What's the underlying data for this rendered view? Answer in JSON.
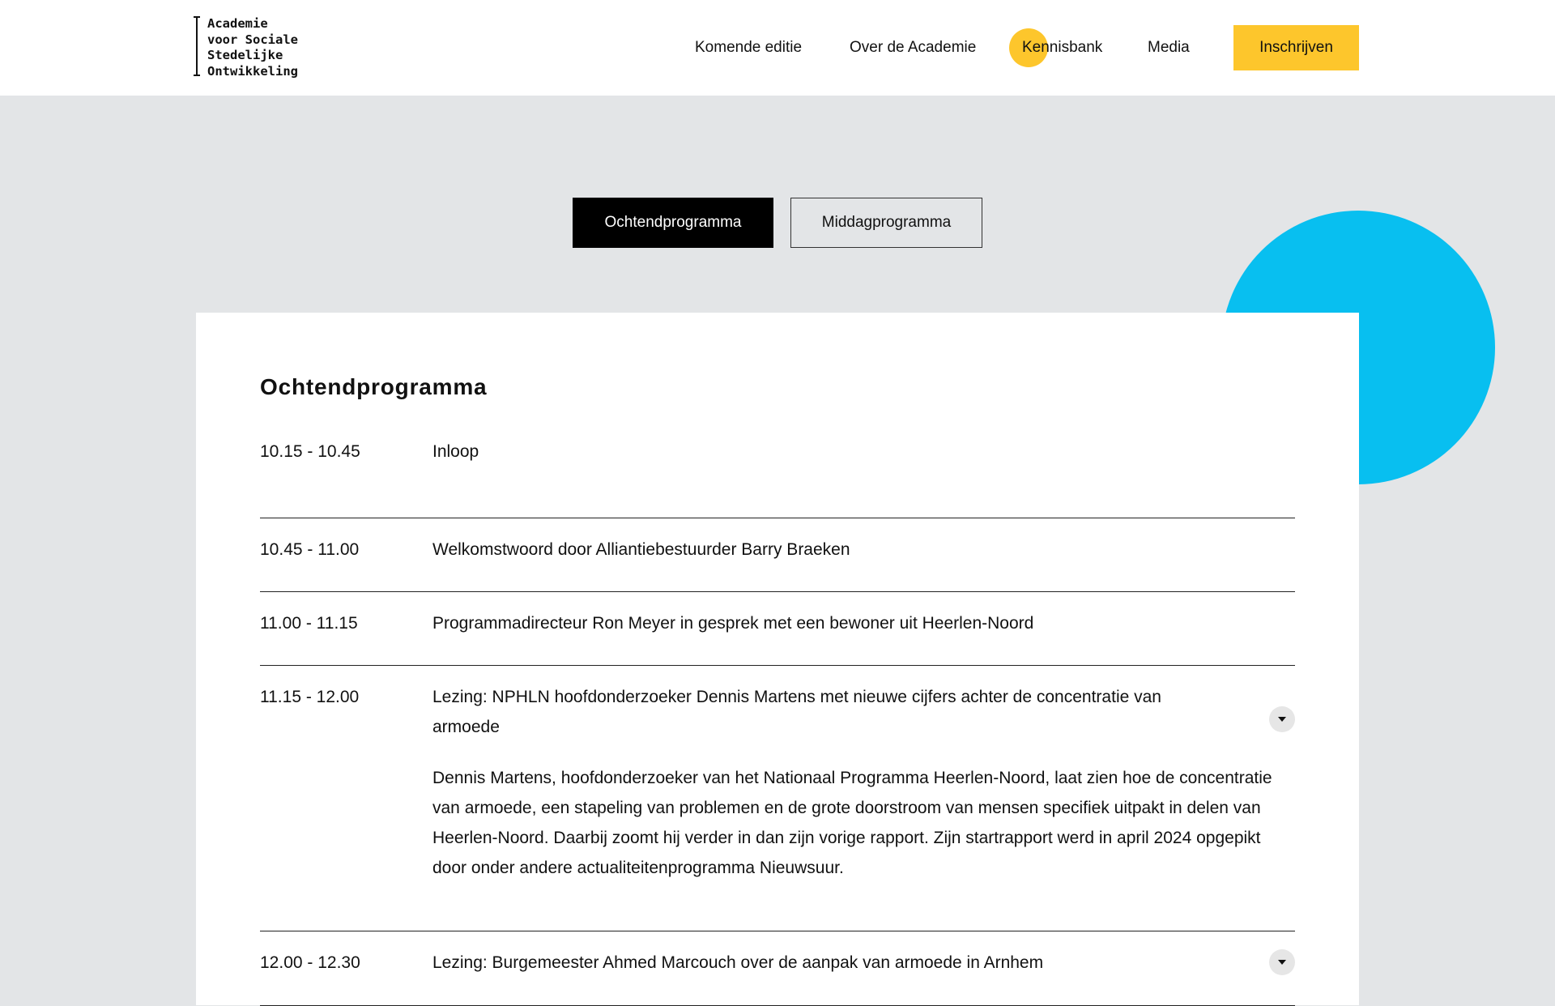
{
  "header": {
    "logo_lines": [
      "Academie",
      "voor Sociale",
      "Stedelijke",
      "Ontwikkeling"
    ],
    "nav": [
      "Komende editie",
      "Over de Academie",
      "Kennisbank",
      "Media"
    ],
    "cta_label": "Inschrijven"
  },
  "tabs": {
    "morning": "Ochtendprogramma",
    "afternoon": "Middagprogramma",
    "active": "morning"
  },
  "program": {
    "title": "Ochtendprogramma",
    "items": [
      {
        "time": "10.15 - 10.45",
        "title": "Inloop"
      },
      {
        "time": "10.45 - 11.00",
        "title": "Welkomstwoord door Alliantiebestuurder Barry Braeken"
      },
      {
        "time": "11.00 - 11.15",
        "title": "Programmadirecteur Ron Meyer in gesprek met een bewoner uit Heerlen-Noord"
      },
      {
        "time": "11.15 - 12.00",
        "title": "Lezing: NPHLN hoofdonderzoeker Dennis Martens met nieuwe cijfers achter de concentratie van armoede",
        "description": "Dennis Martens, hoofdonderzoeker van het Nationaal Programma Heerlen-Noord, laat zien hoe de concentratie van armoede, een stapeling van problemen en de grote doorstroom van mensen specifiek uitpakt in delen van Heerlen-Noord. Daarbij zoomt hij verder in dan zijn vorige rapport. Zijn startrapport werd in april 2024 opgepikt door onder andere actualiteitenprogramma Nieuwsuur."
      },
      {
        "time": "12.00 - 12.30",
        "title": "Lezing: Burgemeester Ahmed Marcouch over de aanpak van armoede in Arnhem"
      }
    ]
  },
  "colors": {
    "accent_yellow": "#fdc62c",
    "accent_blue": "#08bff0",
    "page_background": "#e3e5e7"
  },
  "icons": {
    "expand_toggle": "chevron-down-icon"
  }
}
